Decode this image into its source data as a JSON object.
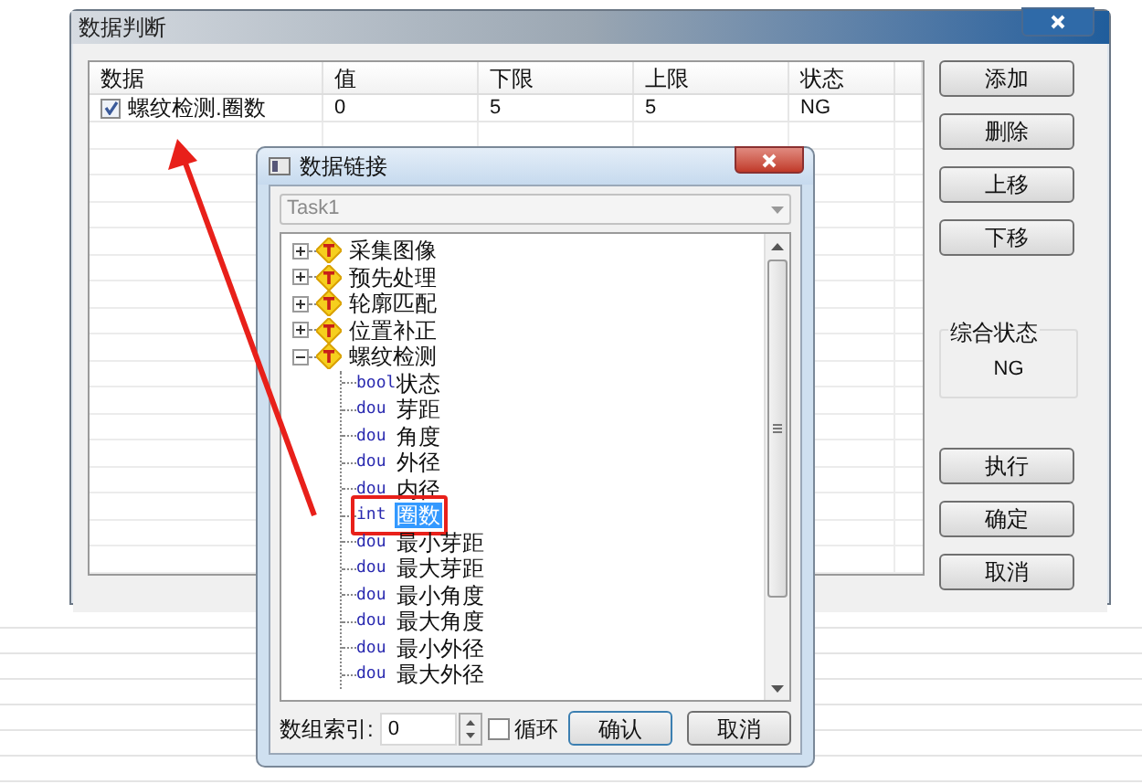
{
  "window": {
    "title": "数据判断"
  },
  "table": {
    "columns": [
      "数据",
      "值",
      "下限",
      "上限",
      "状态"
    ],
    "rows": [
      {
        "checked": true,
        "cells": [
          "螺纹检测.圈数",
          "0",
          "5",
          "5",
          "NG"
        ]
      }
    ]
  },
  "side_buttons": [
    "添加",
    "删除",
    "上移",
    "下移"
  ],
  "summary": {
    "label": "综合状态",
    "value": "NG"
  },
  "action_buttons": [
    "执行",
    "确定",
    "取消"
  ],
  "link_dialog": {
    "title": "数据链接",
    "task": "Task1",
    "tree": [
      {
        "label": "采集图像",
        "expanded": false
      },
      {
        "label": "预先处理",
        "expanded": false
      },
      {
        "label": "轮廓匹配",
        "expanded": false
      },
      {
        "label": "位置补正",
        "expanded": false
      },
      {
        "label": "螺纹检测",
        "expanded": true,
        "children": [
          {
            "type": "bool",
            "label": "状态",
            "selected": false
          },
          {
            "type": "dou",
            "label": "芽距",
            "selected": false
          },
          {
            "type": "dou",
            "label": "角度",
            "selected": false
          },
          {
            "type": "dou",
            "label": "外径",
            "selected": false
          },
          {
            "type": "dou",
            "label": "内径",
            "selected": false
          },
          {
            "type": "int",
            "label": "圈数",
            "selected": true
          },
          {
            "type": "dou",
            "label": "最小芽距",
            "selected": false
          },
          {
            "type": "dou",
            "label": "最大芽距",
            "selected": false
          },
          {
            "type": "dou",
            "label": "最小角度",
            "selected": false
          },
          {
            "type": "dou",
            "label": "最大角度",
            "selected": false
          },
          {
            "type": "dou",
            "label": "最小外径",
            "selected": false
          },
          {
            "type": "dou",
            "label": "最大外径",
            "selected": false
          }
        ]
      }
    ],
    "index_label": "数组索引:",
    "index_value": "0",
    "loop": {
      "label": "循环",
      "checked": false
    },
    "buttons": [
      "确认",
      "取消"
    ]
  }
}
